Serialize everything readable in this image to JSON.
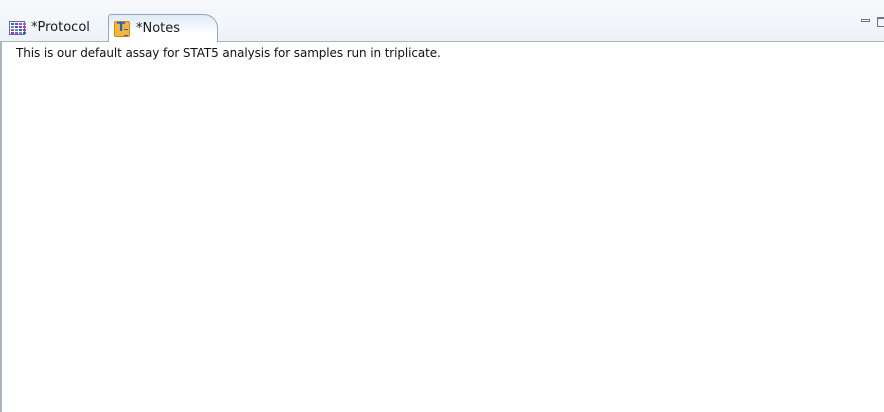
{
  "tabs": [
    {
      "label": "*Protocol",
      "icon": "grid-table-icon",
      "active": false
    },
    {
      "label": "*Notes",
      "icon": "text-document-icon",
      "active": true
    }
  ],
  "view_controls": {
    "minimize_icon": "minimize-icon",
    "maximize_icon": "maximize-icon"
  },
  "editor": {
    "content": "This is our default assay for STAT5 analysis for samples run in triplicate."
  },
  "colors": {
    "tab_border": "#97a7bd",
    "active_tab_top": "#dfe9f7",
    "grid_icon_colors": [
      "#3b5cc6",
      "#8a3bd0",
      "#c43bb0",
      "#3b9ad0"
    ],
    "notes_icon": "#f4b63c"
  }
}
